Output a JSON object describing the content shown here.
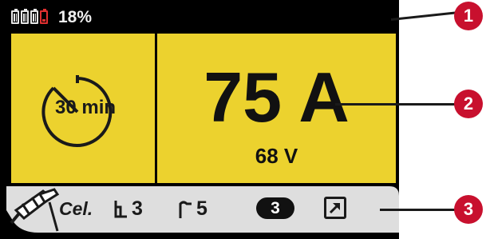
{
  "status": {
    "battery_percent": "18%",
    "battery_level": 0.18,
    "low_battery_color": "#e03030"
  },
  "timer": {
    "value": "30 min",
    "icon": "timer-icon"
  },
  "readout": {
    "current": "75 A",
    "voltage": "68 V"
  },
  "bottom_bar": {
    "electrode_icon": "electrode-holder-icon",
    "electrode_type": "Cel.",
    "param1_icon": "hot-start-icon",
    "param1_value": "3",
    "param2_icon": "arc-force-icon",
    "param2_value": "5",
    "program_number": "3",
    "trend_icon": "arrow-up-right-icon"
  },
  "callouts": [
    "1",
    "2",
    "3"
  ],
  "colors": {
    "panel_yellow": "#ecd22e",
    "screen_black": "#000000",
    "bar_gray": "#dedede",
    "callout_red": "#c8102e"
  }
}
